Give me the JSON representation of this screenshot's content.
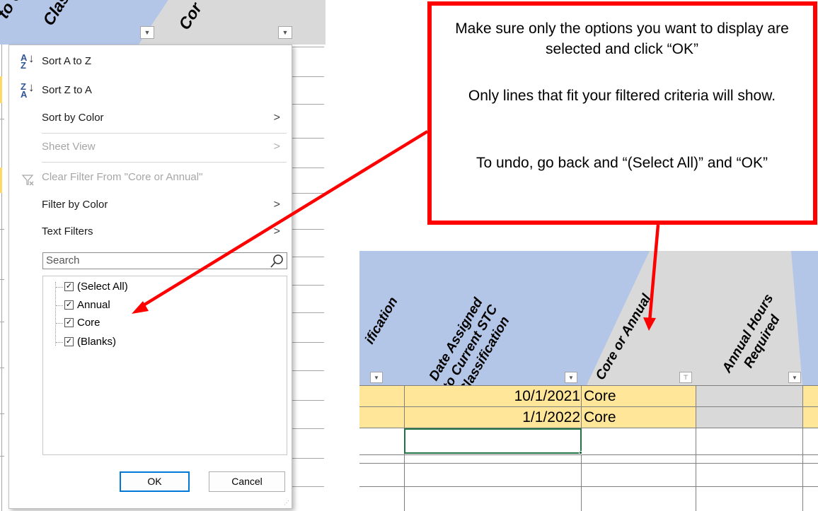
{
  "left_header": {
    "col1_fragment": "to C",
    "col1_fragment_line2": "Clas",
    "col2_fragment": "Cor"
  },
  "menu": {
    "sort_az": "Sort A to Z",
    "sort_za": "Sort Z to A",
    "sort_by_color": "Sort by Color",
    "sheet_view": "Sheet View",
    "clear_filter": "Clear Filter From \"Core or Annual\"",
    "filter_by_color": "Filter by Color",
    "text_filters": "Text Filters",
    "search_placeholder": "Search",
    "items": [
      {
        "label": "(Select All)",
        "checked": true
      },
      {
        "label": "Annual",
        "checked": true
      },
      {
        "label": "Core",
        "checked": true
      },
      {
        "label": "(Blanks)",
        "checked": true
      }
    ],
    "ok_label": "OK",
    "cancel_label": "Cancel"
  },
  "callout": {
    "line1": "Make sure only the options you want to display are selected and click “OK”",
    "line2": "Only lines that fit your filtered criteria will show.",
    "line3": "To undo, go back and “(Select All)” and “OK”"
  },
  "sheet": {
    "headers": {
      "col_a": "ification",
      "col_b_line1": "Date Assigned",
      "col_b_line2": "to Current STC",
      "col_b_line3": "Classification",
      "col_c": "Core or Annual",
      "col_d_line1": "Annual Hours",
      "col_d_line2": "Required"
    },
    "rows": [
      {
        "date": "10/1/2021",
        "type": "Core"
      },
      {
        "date": "1/1/2022",
        "type": "Core"
      }
    ]
  },
  "colors": {
    "header_blue": "#b4c6e7",
    "header_gray": "#d9d9d9",
    "row_tan": "#ffe699",
    "accent_red": "#ff0000",
    "selection_green": "#217346"
  }
}
